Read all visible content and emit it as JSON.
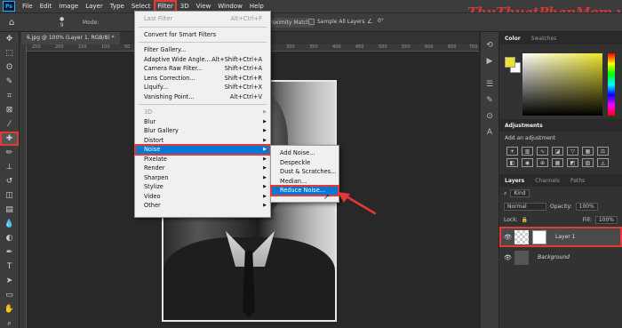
{
  "app": {
    "logo": "Ps"
  },
  "menubar": [
    "File",
    "Edit",
    "Image",
    "Layer",
    "Type",
    "Select",
    "Filter",
    "3D",
    "View",
    "Window",
    "Help"
  ],
  "options_bar": {
    "brush_size": "9",
    "mode_label": "Mode:",
    "proximity_label": "roximity Match",
    "sample_all_layers": "Sample All Layers",
    "angle_icon": "angle-icon",
    "angle_value": "0°"
  },
  "document": {
    "tab_title": "6.jpg @ 100% (Layer 1, RGB/8) *",
    "ruler_ticks": [
      "250",
      "200",
      "150",
      "100",
      "50",
      "0",
      "50",
      "100",
      "150",
      "200",
      "250",
      "300",
      "350",
      "400",
      "450",
      "500",
      "550",
      "600",
      "650",
      "700"
    ]
  },
  "filter_menu": {
    "items": [
      {
        "label": "Last Filter",
        "shortcut": "Alt+Ctrl+F",
        "disabled": true
      },
      {
        "sep": true
      },
      {
        "label": "Convert for Smart Filters"
      },
      {
        "sep": true
      },
      {
        "label": "Filter Gallery..."
      },
      {
        "label": "Adaptive Wide Angle...",
        "shortcut": "Alt+Shift+Ctrl+A"
      },
      {
        "label": "Camera Raw Filter...",
        "shortcut": "Shift+Ctrl+A"
      },
      {
        "label": "Lens Correction...",
        "shortcut": "Shift+Ctrl+R"
      },
      {
        "label": "Liquify...",
        "shortcut": "Shift+Ctrl+X"
      },
      {
        "label": "Vanishing Point...",
        "shortcut": "Alt+Ctrl+V"
      },
      {
        "sep": true
      },
      {
        "label": "3D",
        "submenu": true,
        "disabled": true
      },
      {
        "label": "Blur",
        "submenu": true
      },
      {
        "label": "Blur Gallery",
        "submenu": true
      },
      {
        "label": "Distort",
        "submenu": true
      },
      {
        "label": "Noise",
        "submenu": true,
        "highlight": true
      },
      {
        "label": "Pixelate",
        "submenu": true
      },
      {
        "label": "Render",
        "submenu": true
      },
      {
        "label": "Sharpen",
        "submenu": true
      },
      {
        "label": "Stylize",
        "submenu": true
      },
      {
        "label": "Video",
        "submenu": true
      },
      {
        "label": "Other",
        "submenu": true
      }
    ]
  },
  "noise_submenu": [
    "Add Noise...",
    "Despeckle",
    "Dust & Scratches...",
    "Median...",
    "Reduce Noise..."
  ],
  "watermark": "ThuThuatPhanMem.vn",
  "panels": {
    "color_tabs": [
      "Color",
      "Swatches"
    ],
    "fg_color": "#eee22a",
    "adjustments_title": "Adjustments",
    "adjustments_sub": "Add an adjustment",
    "layers_tabs": [
      "Layers",
      "Channels",
      "Paths"
    ],
    "kind_label": "Kind",
    "blend_mode": "Normal",
    "opacity_label": "Opacity:",
    "opacity_value": "100%",
    "lock_label": "Lock:",
    "fill_label": "Fill:",
    "fill_value": "100%",
    "layers": [
      {
        "name": "Layer 1",
        "selected": true
      },
      {
        "name": "Background",
        "selected": false
      }
    ]
  },
  "colors": {
    "accent_red": "#e53935",
    "menu_highlight": "#0078d7"
  }
}
